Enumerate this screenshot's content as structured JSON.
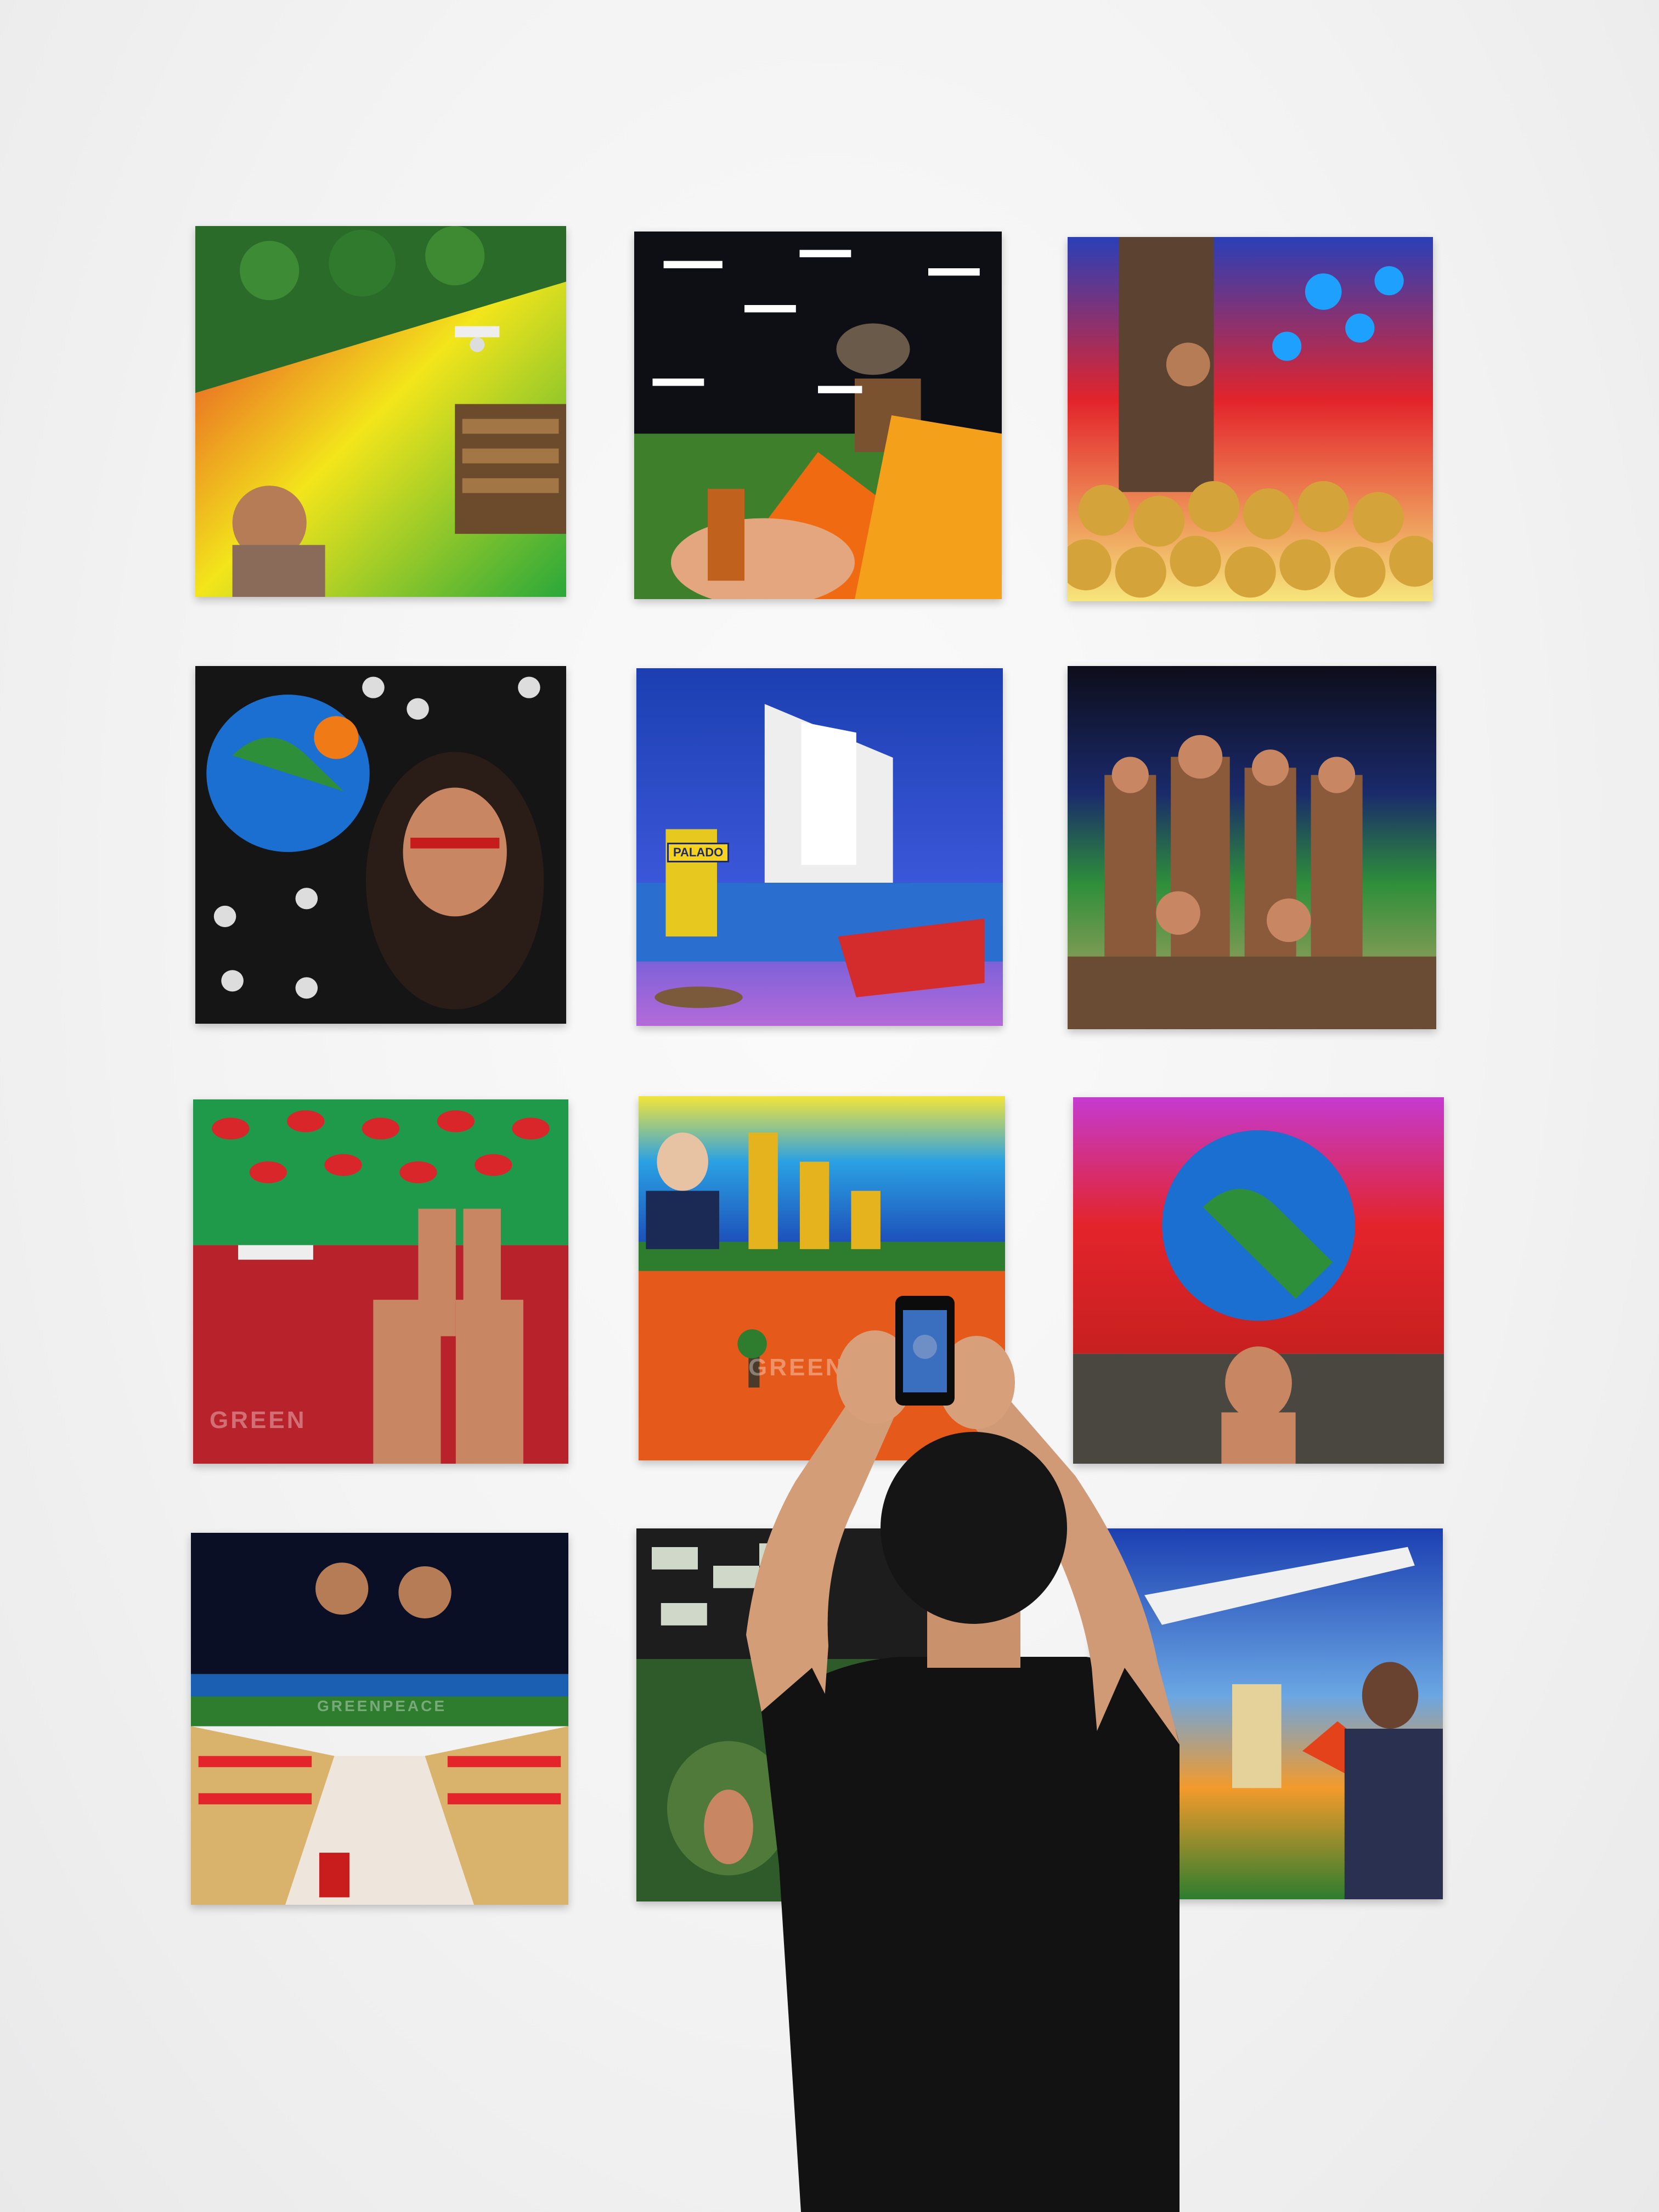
{
  "scene": {
    "description_tag": "gallery-wall",
    "prints_count": 12
  },
  "texts": {
    "jersey_label": "PALADO",
    "watermark_1": "GREEN",
    "watermark_2": "GREENPE",
    "watermark_3": "GREENPEACE"
  },
  "colors": {
    "wall": "#f1f1f1",
    "shirt": "#121212",
    "skin": "#d9a07a"
  }
}
